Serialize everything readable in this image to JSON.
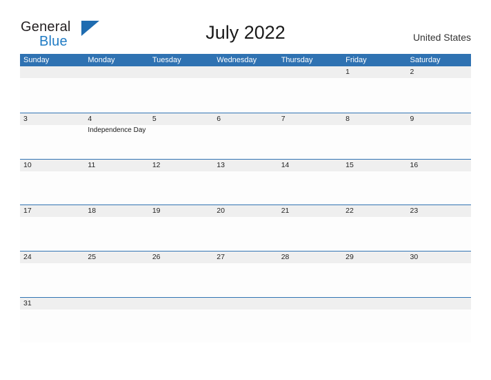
{
  "brand": {
    "name_part1": "General",
    "name_part2": "Blue"
  },
  "header": {
    "title": "July 2022",
    "country": "United States"
  },
  "calendar": {
    "weekday_headers": [
      "Sunday",
      "Monday",
      "Tuesday",
      "Wednesday",
      "Thursday",
      "Friday",
      "Saturday"
    ],
    "accent_color": "#2f72b2",
    "band_color": "#efefef",
    "weeks": [
      {
        "days": [
          {
            "num": "",
            "event": ""
          },
          {
            "num": "",
            "event": ""
          },
          {
            "num": "",
            "event": ""
          },
          {
            "num": "",
            "event": ""
          },
          {
            "num": "",
            "event": ""
          },
          {
            "num": "1",
            "event": ""
          },
          {
            "num": "2",
            "event": ""
          }
        ]
      },
      {
        "days": [
          {
            "num": "3",
            "event": ""
          },
          {
            "num": "4",
            "event": "Independence Day"
          },
          {
            "num": "5",
            "event": ""
          },
          {
            "num": "6",
            "event": ""
          },
          {
            "num": "7",
            "event": ""
          },
          {
            "num": "8",
            "event": ""
          },
          {
            "num": "9",
            "event": ""
          }
        ]
      },
      {
        "days": [
          {
            "num": "10",
            "event": ""
          },
          {
            "num": "11",
            "event": ""
          },
          {
            "num": "12",
            "event": ""
          },
          {
            "num": "13",
            "event": ""
          },
          {
            "num": "14",
            "event": ""
          },
          {
            "num": "15",
            "event": ""
          },
          {
            "num": "16",
            "event": ""
          }
        ]
      },
      {
        "days": [
          {
            "num": "17",
            "event": ""
          },
          {
            "num": "18",
            "event": ""
          },
          {
            "num": "19",
            "event": ""
          },
          {
            "num": "20",
            "event": ""
          },
          {
            "num": "21",
            "event": ""
          },
          {
            "num": "22",
            "event": ""
          },
          {
            "num": "23",
            "event": ""
          }
        ]
      },
      {
        "days": [
          {
            "num": "24",
            "event": ""
          },
          {
            "num": "25",
            "event": ""
          },
          {
            "num": "26",
            "event": ""
          },
          {
            "num": "27",
            "event": ""
          },
          {
            "num": "28",
            "event": ""
          },
          {
            "num": "29",
            "event": ""
          },
          {
            "num": "30",
            "event": ""
          }
        ]
      },
      {
        "days": [
          {
            "num": "31",
            "event": ""
          },
          {
            "num": "",
            "event": ""
          },
          {
            "num": "",
            "event": ""
          },
          {
            "num": "",
            "event": ""
          },
          {
            "num": "",
            "event": ""
          },
          {
            "num": "",
            "event": ""
          },
          {
            "num": "",
            "event": ""
          }
        ]
      }
    ]
  }
}
